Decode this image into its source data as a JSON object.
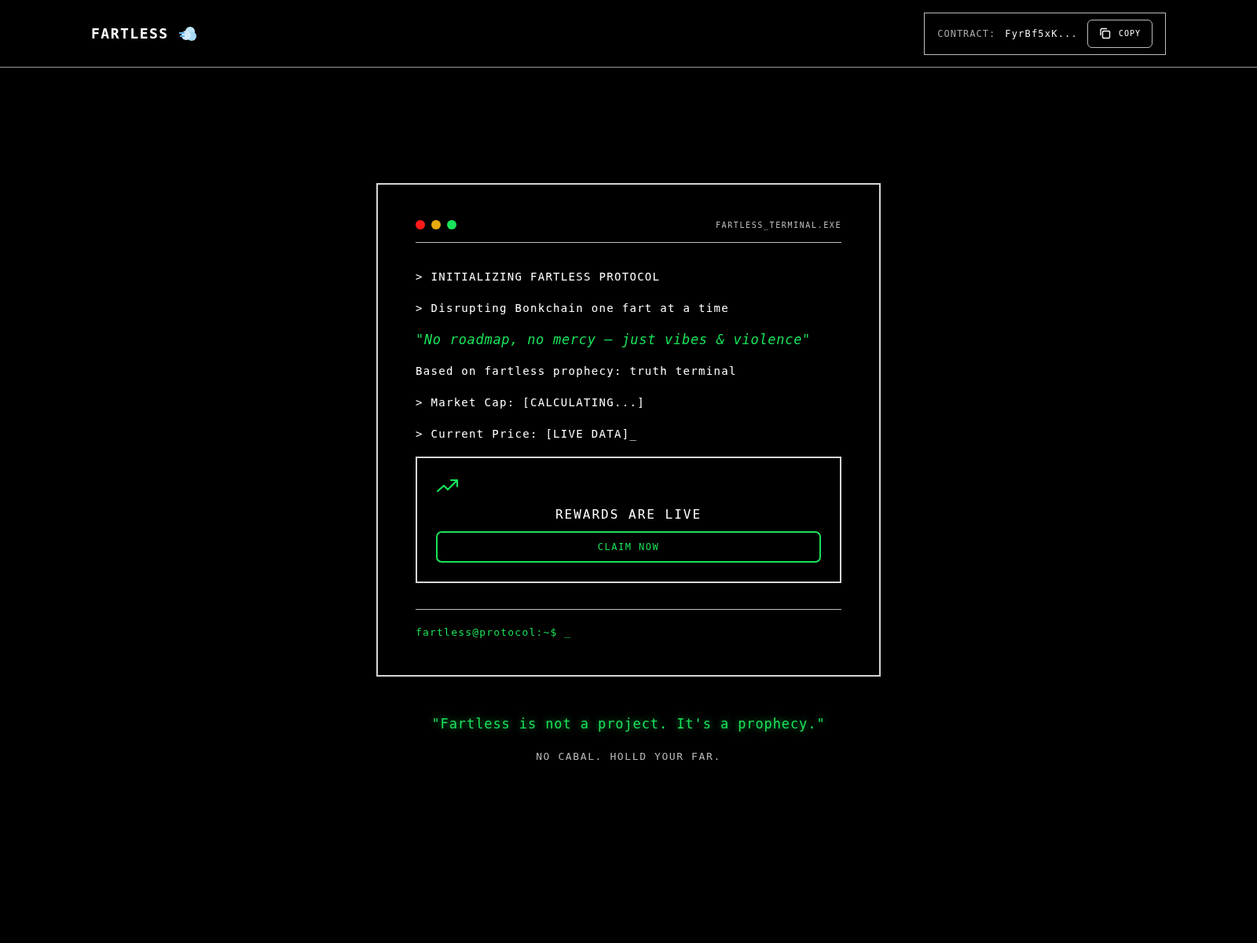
{
  "header": {
    "logo": "FARTLESS",
    "contract_label": "CONTRACT:",
    "contract_value": "FyrBf5xK...",
    "copy_button": "COPY"
  },
  "terminal": {
    "title": "FARTLESS_TERMINAL.EXE",
    "dots": [
      {
        "color": "#ff1a1a"
      },
      {
        "color": "#e8a90e"
      },
      {
        "color": "#19e35a"
      }
    ],
    "lines": [
      {
        "kind": "command",
        "text": "> INITIALIZING FARTLESS PROTOCOL"
      },
      {
        "kind": "command",
        "text": "> Disrupting Bonkchain one fart at a time"
      },
      {
        "kind": "quote",
        "text": "\"No roadmap, no mercy — just vibes & violence\""
      },
      {
        "kind": "plain",
        "text": "Based on fartless prophecy: truth terminal"
      },
      {
        "kind": "command",
        "text": "> Market Cap: [CALCULATING...]"
      },
      {
        "kind": "command",
        "text": "> Current Price: [LIVE DATA]_"
      }
    ],
    "rewards": {
      "title": "REWARDS ARE LIVE",
      "button": "CLAIM NOW"
    },
    "prompt": "fartless@protocol:~$ _"
  },
  "tagline": "\"Fartless is not a project. It's a prophecy.\"",
  "subtitle": "NO CABAL. HOLLD YOUR FAR."
}
